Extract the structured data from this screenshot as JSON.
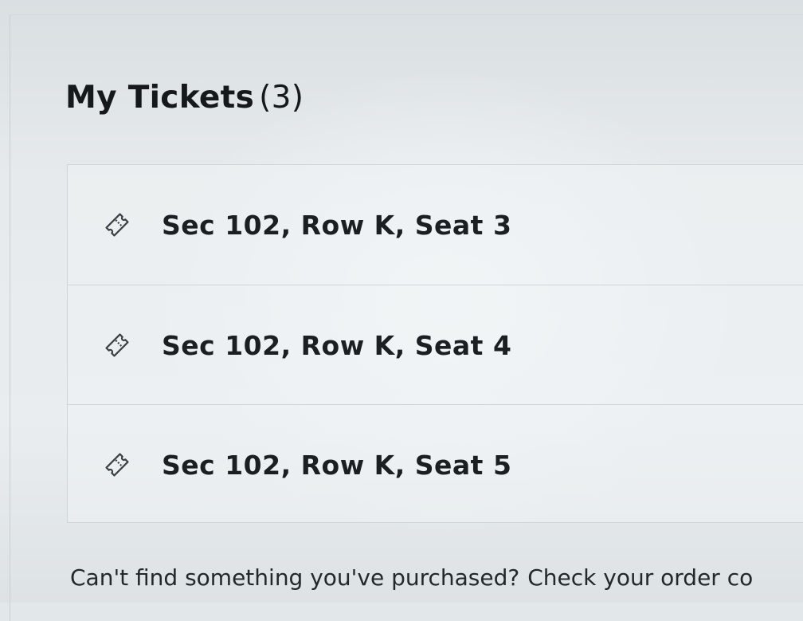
{
  "tickets_section": {
    "title": "My Tickets",
    "count": "(3)",
    "items": [
      {
        "label": "Sec 102, Row K, Seat 3",
        "icon": "ticket-icon"
      },
      {
        "label": "Sec 102, Row K, Seat 4",
        "icon": "ticket-icon"
      },
      {
        "label": "Sec 102, Row K, Seat 5",
        "icon": "ticket-icon"
      }
    ]
  },
  "footer": {
    "question": "Can't find something you've purchased?",
    "link_text": "Check your order co"
  }
}
